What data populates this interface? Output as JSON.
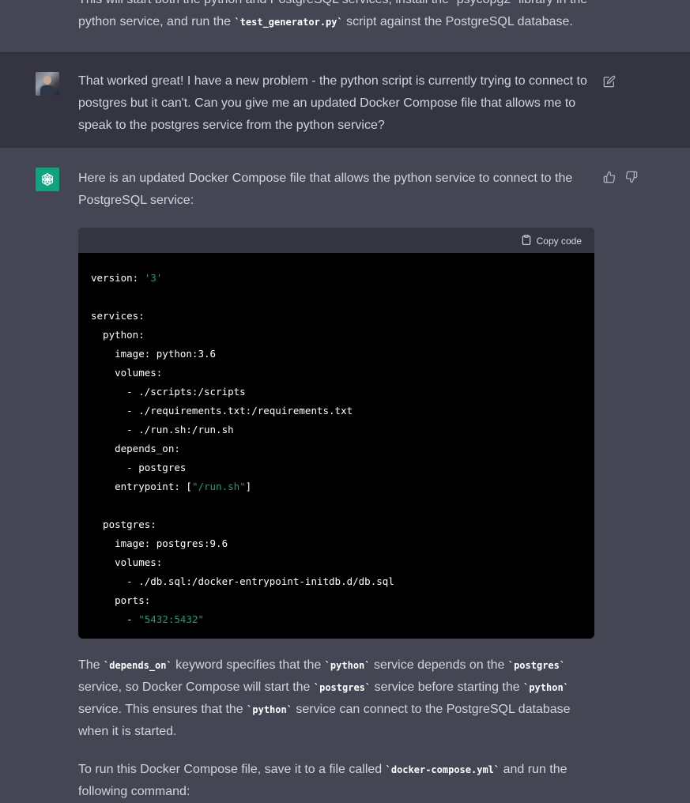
{
  "conversation": {
    "prev_reply_tail": {
      "line1": "This will start both the python and PostgreSQL services, install the `psycopg2` library in the",
      "line2_pre": "python service, and run the ",
      "line2_code": "`test_generator.py`",
      "line2_post": " script against the PostgreSQL database."
    },
    "user_message": {
      "text": "That worked great! I have a new problem - the python script is currently trying to connect to postgres but it can't. Can you give me an updated Docker Compose file that allows me to speak to the postgres service from the python service?"
    },
    "assistant_message": {
      "intro": "Here is an updated Docker Compose file that allows the python service to connect to the PostgreSQL service:",
      "copy_label": "Copy code",
      "code_lines": [
        [
          {
            "t": "version: "
          },
          {
            "t": "'3'",
            "s": true
          }
        ],
        [
          {
            "t": ""
          }
        ],
        [
          {
            "t": "services:"
          }
        ],
        [
          {
            "t": "  python:"
          }
        ],
        [
          {
            "t": "    image: python:3.6"
          }
        ],
        [
          {
            "t": "    volumes:"
          }
        ],
        [
          {
            "t": "      - ./scripts:/scripts"
          }
        ],
        [
          {
            "t": "      - ./requirements.txt:/requirements.txt"
          }
        ],
        [
          {
            "t": "      - ./run.sh:/run.sh"
          }
        ],
        [
          {
            "t": "    depends_on:"
          }
        ],
        [
          {
            "t": "      - postgres"
          }
        ],
        [
          {
            "t": "    entrypoint: ["
          },
          {
            "t": "\"/run.sh\"",
            "s": true
          },
          {
            "t": "]"
          }
        ],
        [
          {
            "t": ""
          }
        ],
        [
          {
            "t": "  postgres:"
          }
        ],
        [
          {
            "t": "    image: postgres:9.6"
          }
        ],
        [
          {
            "t": "    volumes:"
          }
        ],
        [
          {
            "t": "      - ./db.sql:/docker-entrypoint-initdb.d/db.sql"
          }
        ],
        [
          {
            "t": "    ports:"
          }
        ],
        [
          {
            "t": "      - "
          },
          {
            "t": "\"5432:5432\"",
            "s": true
          }
        ]
      ],
      "explanation": {
        "p1": "The ",
        "c1": "`depends_on`",
        "p2": " keyword specifies that the ",
        "c2": "`python`",
        "p3": " service depends on the ",
        "c3": "`postgres`",
        "p4": " service, so Docker Compose will start the ",
        "c4": "`postgres`",
        "p5": " service before starting the ",
        "c5": "`python`",
        "p6": " service. This ensures that the ",
        "c6": "`python`",
        "p7": " service can connect to the PostgreSQL database when it is started."
      },
      "run_instructions": {
        "p1": "To run this Docker Compose file, save it to a file called ",
        "c1": "`docker-compose.yml`",
        "p2": " and run the following command:"
      }
    }
  },
  "icons": {
    "edit": "edit-icon",
    "thumbs_up": "thumbs-up-icon",
    "thumbs_down": "thumbs-down-icon",
    "clipboard": "clipboard-icon",
    "bot_logo": "openai-logo-icon"
  },
  "colors": {
    "user_bg": "#343541",
    "assistant_bg": "#444654",
    "accent": "#10a37f",
    "code_string": "#00a67d"
  }
}
